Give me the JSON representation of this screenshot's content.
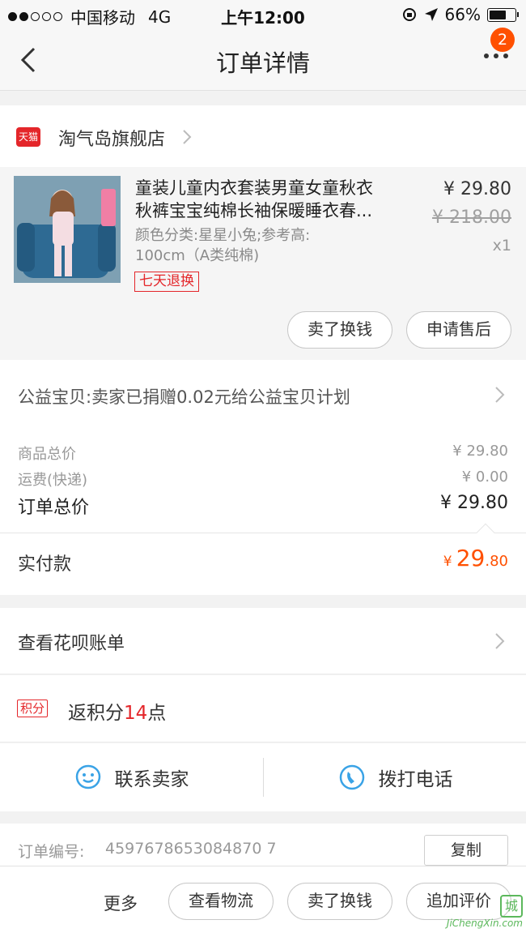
{
  "status_bar": {
    "carrier": "中国移动",
    "network": "4G",
    "time": "上午12:00",
    "battery": "66%",
    "battery_level": 0.66
  },
  "nav": {
    "title": "订单详情",
    "badge": "2"
  },
  "store": {
    "logo": "天猫",
    "name": "淘气岛旗舰店"
  },
  "product": {
    "title_line1": "童装儿童内衣套装男童女童秋衣",
    "title_line2": "秋裤宝宝纯棉长袖保暖睡衣春...",
    "spec_line1": "颜色分类:星星小兔;参考高:",
    "spec_line2": "100cm（A类纯棉)",
    "tag": "七天退换",
    "price": "¥ 29.80",
    "original_price": "¥ 218.00",
    "quantity": "x1",
    "image_tag": "星星小兔",
    "sell_button": "卖了换钱",
    "aftersale_button": "申请售后"
  },
  "charity": {
    "text": "公益宝贝:卖家已捐赠0.02元给公益宝贝计划"
  },
  "totals": {
    "goods_label": "商品总价",
    "goods_value": "¥ 29.80",
    "shipping_label": "运费(快递)",
    "shipping_value": "¥ 0.00",
    "order_label": "订单总价",
    "order_value": "¥ 29.80"
  },
  "paid": {
    "label": "实付款",
    "symbol": "¥",
    "integer": "29",
    "decimal": ".80"
  },
  "huabei": {
    "label": "查看花呗账单"
  },
  "points": {
    "tag": "积分",
    "prefix": "返积分",
    "value": "14",
    "suffix": "点"
  },
  "contact": {
    "seller": "联系卖家",
    "phone": "拨打电话"
  },
  "order": {
    "number_label": "订单编号:",
    "number": "4597678653084870 7",
    "copy": "复制"
  },
  "bottom": {
    "more": "更多",
    "logistics": "查看物流",
    "sell": "卖了换钱",
    "review": "追加评价"
  },
  "watermark": {
    "text": "城",
    "url": "JiChengXin.com"
  },
  "colors": {
    "accent": "#ff5000",
    "tmall_red": "#e4262a",
    "contact_blue": "#3aa3e6"
  }
}
